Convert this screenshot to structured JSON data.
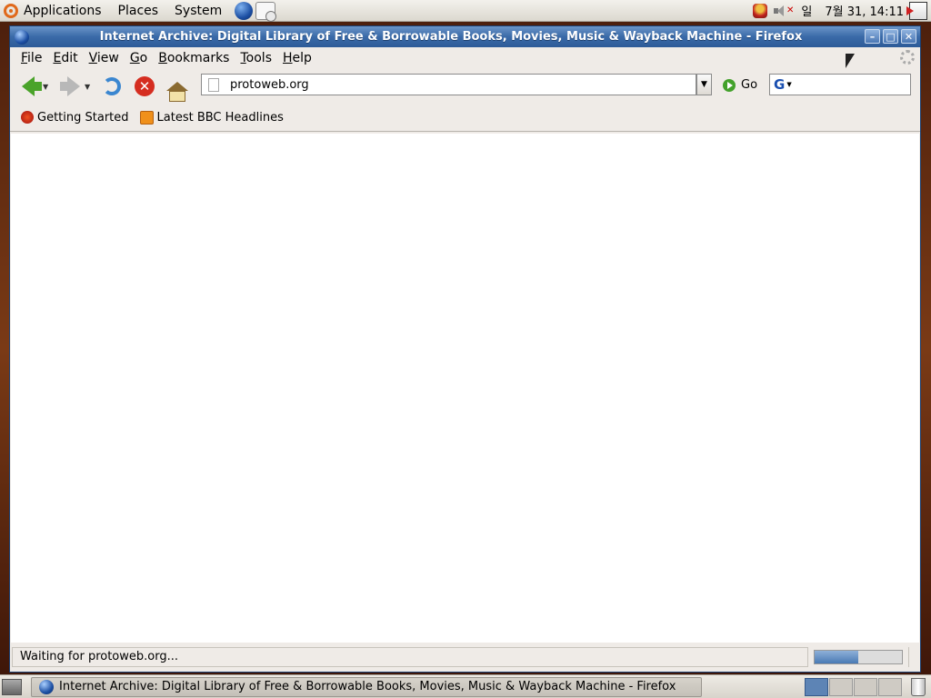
{
  "top_panel": {
    "menus": [
      "Applications",
      "Places",
      "System"
    ],
    "tray": {
      "keyboard_indicator": "일",
      "clock": "7월 31, 14:11"
    }
  },
  "window": {
    "title": "Internet Archive: Digital Library of Free & Borrowable Books, Movies, Music & Wayback Machine - Firefox",
    "controls": {
      "minimize": "–",
      "maximize": "□",
      "close": "✕"
    }
  },
  "menubar": {
    "items": [
      "File",
      "Edit",
      "View",
      "Go",
      "Bookmarks",
      "Tools",
      "Help"
    ]
  },
  "navbar": {
    "url": "protoweb.org",
    "go_label": "Go",
    "search_value": ""
  },
  "bookmarks": {
    "items": [
      "Getting Started",
      "Latest BBC Headlines"
    ]
  },
  "statusbar": {
    "text": "Waiting for protoweb.org...",
    "progress": 0.5
  },
  "taskbar": {
    "task_title": "Internet Archive: Digital Library of Free & Borrowable Books, Movies, Music & Wayback Machine - Firefox",
    "workspaces": 4,
    "active_workspace": 1
  }
}
